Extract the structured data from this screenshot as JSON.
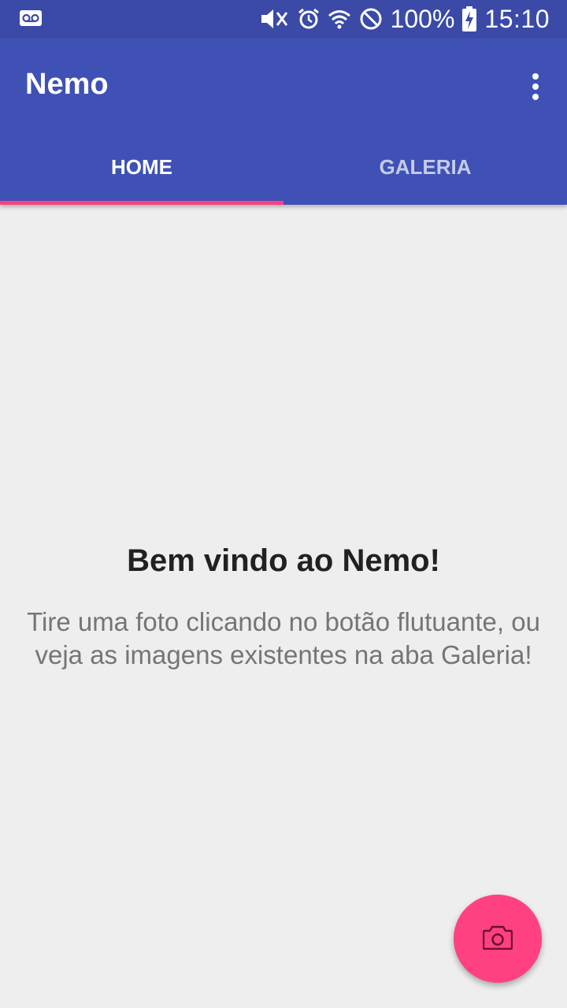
{
  "status_bar": {
    "battery": "100%",
    "time": "15:10",
    "icons": [
      "voicemail-icon",
      "mute-icon",
      "alarm-icon",
      "wifi-icon",
      "do-not-disturb-icon",
      "battery-charging-icon"
    ]
  },
  "app_bar": {
    "title": "Nemo",
    "menu_icon": "overflow-menu-icon"
  },
  "tabs": [
    {
      "label": "HOME",
      "active": true
    },
    {
      "label": "GALERIA",
      "active": false
    }
  ],
  "main": {
    "title": "Bem vindo ao Nemo!",
    "message": "Tire uma foto clicando no botão flutuante, ou veja as imagens existentes na aba Galeria!"
  },
  "fab": {
    "icon": "camera-icon"
  },
  "colors": {
    "primary": "#3f51b5",
    "primary_dark": "#3a4aa6",
    "accent": "#ff4081",
    "background": "#eeeeee"
  }
}
